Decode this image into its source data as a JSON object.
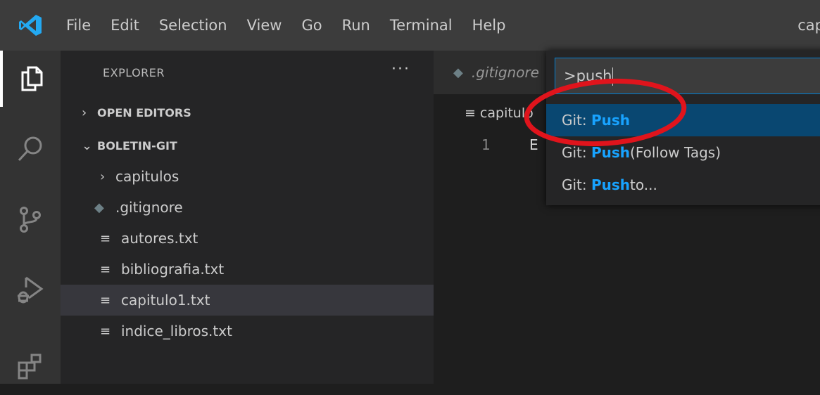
{
  "menu": [
    "File",
    "Edit",
    "Selection",
    "View",
    "Go",
    "Run",
    "Terminal",
    "Help"
  ],
  "window_title": "cap",
  "sidebar": {
    "title": "EXPLORER",
    "more": "···",
    "open_editors": "OPEN EDITORS",
    "project": "BOLETIN-GIT",
    "items": [
      {
        "label": "capitulos",
        "kind": "folder"
      },
      {
        "label": ".gitignore",
        "kind": "git"
      },
      {
        "label": "autores.txt",
        "kind": "file"
      },
      {
        "label": "bibliografia.txt",
        "kind": "file"
      },
      {
        "label": "capitulo1.txt",
        "kind": "file",
        "selected": true
      },
      {
        "label": "indice_libros.txt",
        "kind": "file"
      }
    ]
  },
  "editor": {
    "tab_label": ".gitignore",
    "breadcrumb": "capitulo",
    "line_number": "1",
    "line_text": "E"
  },
  "palette": {
    "input_value": ">push",
    "items": [
      {
        "prefix": "Git: ",
        "match": "Push",
        "suffix": ""
      },
      {
        "prefix": "Git: ",
        "match": "Push",
        "suffix": " (Follow Tags)"
      },
      {
        "prefix": "Git: ",
        "match": "Push",
        "suffix": " to..."
      }
    ]
  },
  "colors": {
    "accent": "#007acc",
    "highlight": "#18a3ff",
    "selection": "#094771",
    "annotation": "#e0141c"
  },
  "icons": [
    "vscode-logo",
    "explorer-icon",
    "search-icon",
    "source-control-icon",
    "run-debug-icon",
    "extensions-icon",
    "chevron-right-icon",
    "chevron-down-icon",
    "file-lines-icon",
    "git-file-icon"
  ]
}
